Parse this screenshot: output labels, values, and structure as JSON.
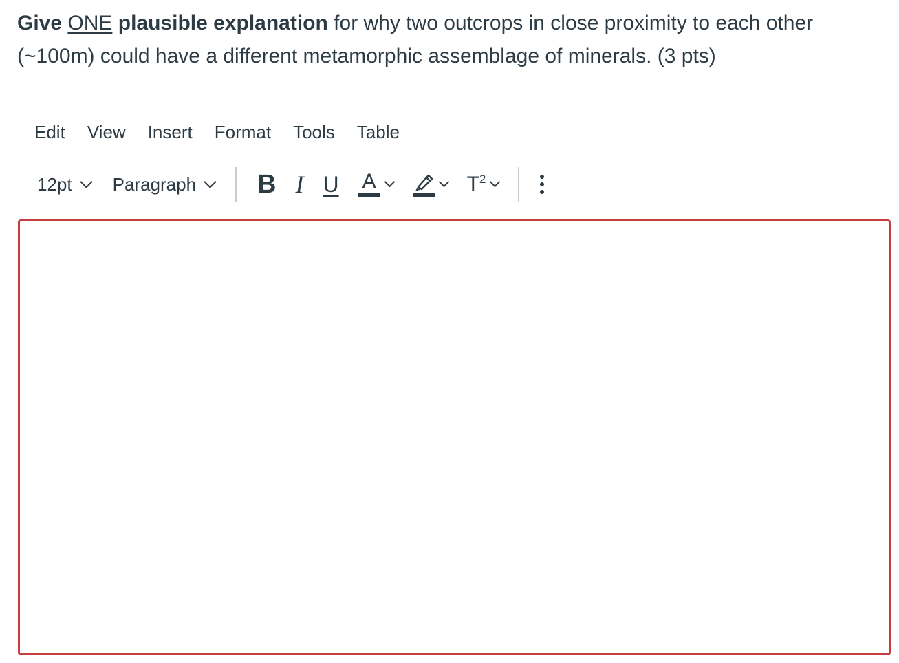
{
  "question": {
    "part1_bold": "Give",
    "part2_underlined": "ONE",
    "part3_bold": "plausible explanation",
    "part4": "for why two outcrops in close proximity to each other (~100m) could have a different metamorphic assemblage of minerals.  (3 pts)"
  },
  "menubar": {
    "edit": "Edit",
    "view": "View",
    "insert": "Insert",
    "format": "Format",
    "tools": "Tools",
    "table": "Table"
  },
  "toolbar": {
    "font_size": "12pt",
    "block_format": "Paragraph",
    "bold": "B",
    "italic": "I",
    "underline": "U",
    "text_color": "A",
    "superscript_base": "T",
    "superscript_exp": "2"
  },
  "editor": {
    "content": "",
    "border_color": "#c53d3d"
  },
  "icons": {
    "highlight": "highlighter-pen-icon",
    "more": "vertical-dots-icon"
  }
}
